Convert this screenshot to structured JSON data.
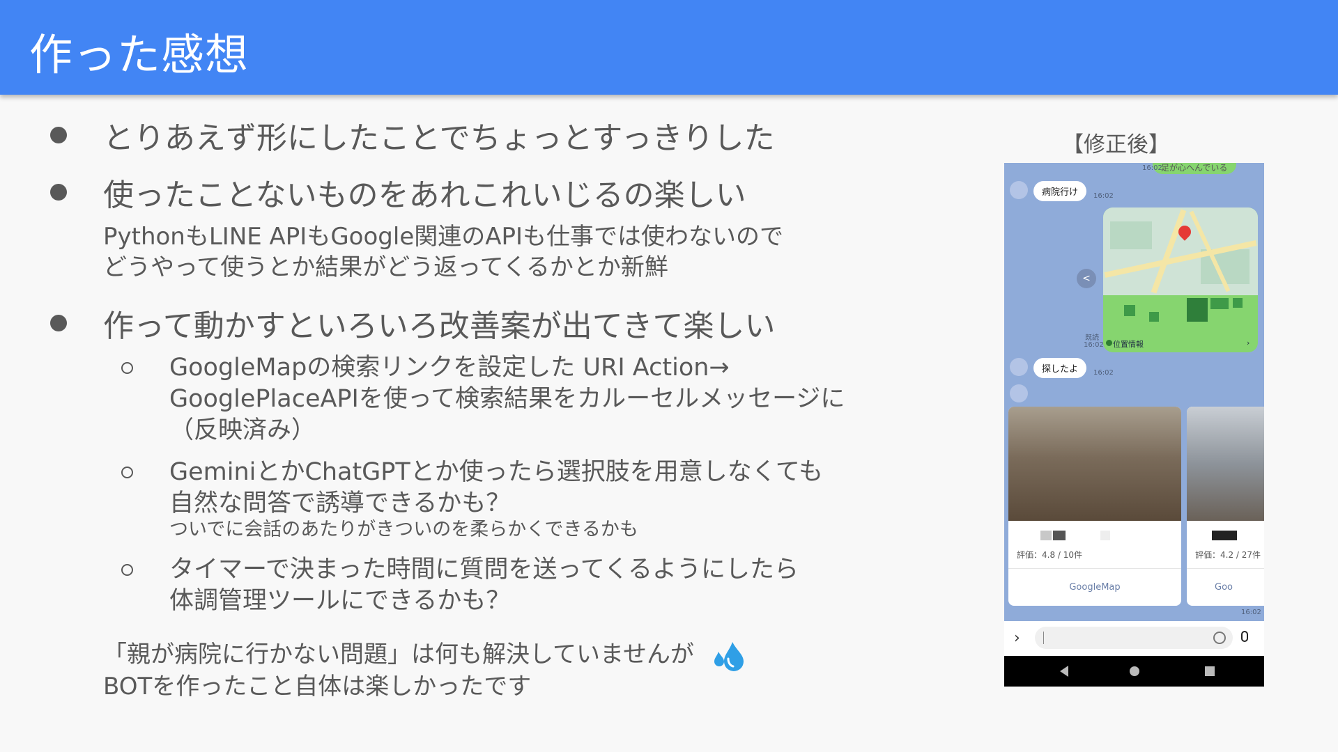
{
  "slide": {
    "title": "作った感想",
    "bullets": [
      {
        "text": "とりあえず形にしたことでちょっとすっきりした"
      },
      {
        "text": "使ったことないものをあれこれいじるの楽しい"
      },
      {
        "text": "作って動かすといろいろ改善案が出てきて楽しい"
      }
    ],
    "paragraph": [
      "PythonもLINE APIもGoogle関連のAPIも仕事では使わないので",
      "どうやって使うとか結果がどう返ってくるかとか新鮮"
    ],
    "sub_items": [
      {
        "lines": [
          "GoogleMapの検索リンクを設定した URI Action→",
          "GooglePlaceAPIを使って検索結果をカルーセルメッセージに",
          "（反映済み）"
        ]
      },
      {
        "lines": [
          "GeminiとかChatGPTとか使ったら選択肢を用意しなくても",
          "自然な問答で誘導できるかも？"
        ],
        "note": "ついでに会話のあたりがきついのを柔らかくできるかも"
      },
      {
        "lines": [
          "タイマーで決まった時間に質問を送ってくるようにしたら",
          "体調管理ツールにできるかも？"
        ]
      }
    ],
    "closing": [
      "「親が病院に行かない問題」は何も解決していませんが",
      "BOTを作ったこと自体は楽しかったです"
    ],
    "closing_icon": "sweat-droplets-icon"
  },
  "phone": {
    "caption": "【修正後】",
    "top_bubble_partial": "足が心へんでいる",
    "top_time": "16:02",
    "msg1": {
      "text": "病院行け",
      "time": "16:02"
    },
    "map": {
      "read_label": "既読",
      "time": "16:02",
      "location_label": "位置情報",
      "chevron": "›"
    },
    "msg2": {
      "text": "探したよ",
      "time": "16:02"
    },
    "cards": [
      {
        "rating": "評価：4.8 / 10件",
        "button": "GoogleMap"
      },
      {
        "rating": "評価：4.2 / 27件",
        "button": "Goo"
      }
    ],
    "carousel_time": "16:02",
    "input_chevron": "›"
  },
  "colors": {
    "header": "#4285f4",
    "text": "#595959",
    "line_green": "#86d56f"
  }
}
